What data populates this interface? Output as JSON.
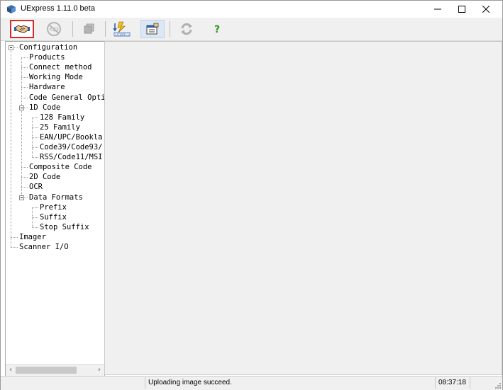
{
  "window": {
    "title": "UExpress 1.11.0 beta",
    "controls": [
      "minimize",
      "maximize",
      "close"
    ]
  },
  "toolbar": {
    "buttons": [
      {
        "icon": "handshake-connect-icon",
        "state": "active"
      },
      {
        "icon": "disconnect-icon",
        "state": "disabled"
      },
      {
        "icon": "copy-icon",
        "state": "disabled"
      },
      {
        "icon": "lightning-barcode-icon",
        "state": "normal"
      },
      {
        "icon": "properties-icon",
        "state": "pressed"
      },
      {
        "icon": "refresh-icon",
        "state": "disabled"
      },
      {
        "icon": "help-icon",
        "state": "normal"
      }
    ]
  },
  "tree": {
    "items": [
      {
        "label": "Configuration",
        "level": 0,
        "expandable": true
      },
      {
        "label": "Products",
        "level": 1
      },
      {
        "label": "Connect method",
        "level": 1
      },
      {
        "label": "Working Mode",
        "level": 1
      },
      {
        "label": "Hardware",
        "level": 1
      },
      {
        "label": "Code General Opti",
        "level": 1
      },
      {
        "label": "1D Code",
        "level": 1,
        "expandable": true
      },
      {
        "label": "128 Family",
        "level": 2
      },
      {
        "label": "25 Family",
        "level": 2
      },
      {
        "label": "EAN/UPC/Bookla",
        "level": 2
      },
      {
        "label": "Code39/Code93/",
        "level": 2
      },
      {
        "label": "RSS/Code11/MSI",
        "level": 2
      },
      {
        "label": "Composite Code",
        "level": 1
      },
      {
        "label": "2D Code",
        "level": 1
      },
      {
        "label": "OCR",
        "level": 1
      },
      {
        "label": "Data Formats",
        "level": 1,
        "expandable": true
      },
      {
        "label": "Prefix",
        "level": 2
      },
      {
        "label": "Suffix",
        "level": 2
      },
      {
        "label": "Stop Suffix",
        "level": 2
      },
      {
        "label": "Imager",
        "level": 0
      },
      {
        "label": "Scanner I/O",
        "level": 0
      }
    ]
  },
  "status": {
    "message": "Uploading image succeed.",
    "time": "08:37:18"
  },
  "colors": {
    "accent_border": "#d62b2b",
    "panel_bg": "#f0f0f0"
  }
}
